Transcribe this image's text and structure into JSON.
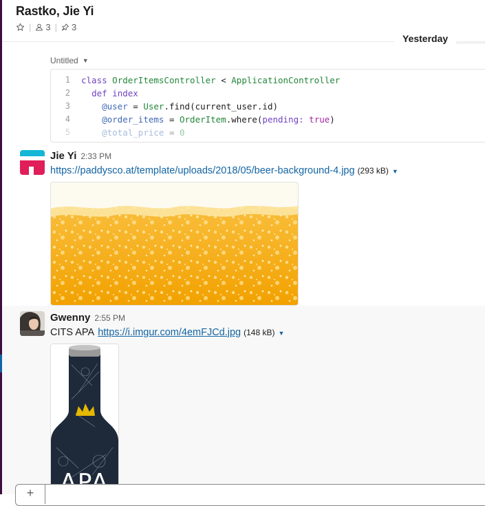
{
  "header": {
    "title": "Rastko, Jie Yi",
    "members_count": "3",
    "pinned_count": "3"
  },
  "day_divider": "Yesterday",
  "snippet": {
    "title": "Untitled",
    "line_numbers": [
      "1",
      "2",
      "3",
      "4",
      "5"
    ]
  },
  "messages": [
    {
      "sender": "Jie Yi",
      "time": "2:33 PM",
      "link": "https://paddysco.at/template/uploads/2018/05/beer-background-4.jpg",
      "size": "(293 kB)"
    },
    {
      "sender": "Gwenny",
      "time": "2:55 PM",
      "text_prefix": "CITS APA",
      "link": "https://i.imgur.com/4emFJCd.jpg",
      "size": "(148 kB)",
      "image_text": "APA"
    }
  ],
  "composer": {
    "plus_label": "+"
  },
  "colors": {
    "sidebar": "#3f0e40",
    "link": "#1264a3",
    "beer": "#f5a300"
  }
}
